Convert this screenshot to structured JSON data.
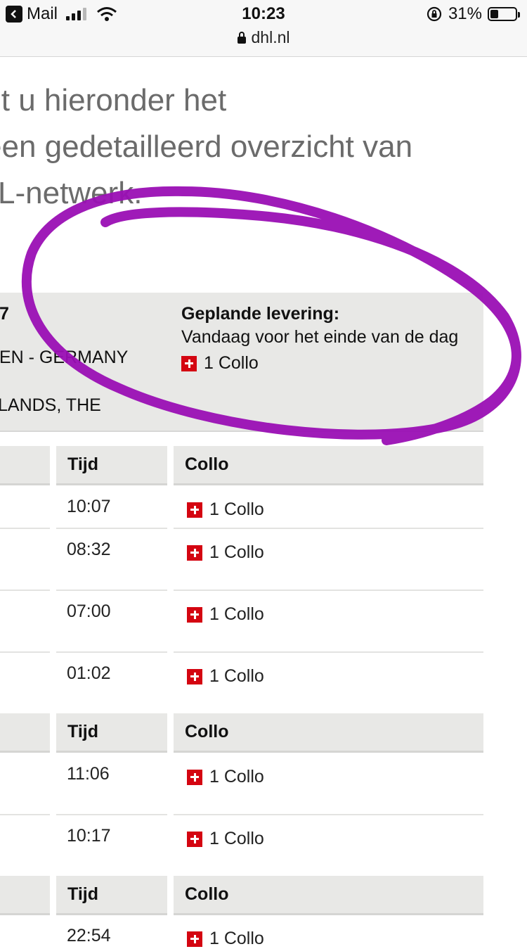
{
  "status_bar": {
    "back_app": "Mail",
    "time": "10:23",
    "battery_percent": "31%",
    "battery_level": 0.31,
    "url": "dhl.nl"
  },
  "intro": {
    "line1": "lt u hieronder het",
    "line2": "een gedetailleerd overzicht van",
    "line3": "L-netwerk."
  },
  "summary": {
    "left_line1": "7",
    "left_line2": "IEN - GERMANY",
    "left_line3": "LANDS, THE",
    "delivery_heading": "Geplande levering:",
    "delivery_text": "Vandaag voor het einde van de dag",
    "collo": "1 Collo"
  },
  "tables": [
    {
      "header_time": "Tijd",
      "header_collo": "Collo",
      "rows": [
        {
          "time": "10:07",
          "collo": "1 Collo"
        },
        {
          "time": "08:32",
          "collo": "1 Collo"
        },
        {
          "time": "07:00",
          "collo": "1 Collo"
        },
        {
          "time": "01:02",
          "collo": "1 Collo"
        }
      ]
    },
    {
      "header_time": "Tijd",
      "header_collo": "Collo",
      "rows": [
        {
          "time": "11:06",
          "collo": "1 Collo"
        },
        {
          "time": "10:17",
          "collo": "1 Collo"
        }
      ]
    },
    {
      "header_time": "Tijd",
      "header_collo": "Collo",
      "rows": [
        {
          "time": "22:54",
          "collo": "1 Collo"
        }
      ]
    }
  ],
  "colors": {
    "annotation": "#9a0fb4",
    "dhl_red": "#d40511",
    "panel_bg": "#e8e8e6"
  }
}
